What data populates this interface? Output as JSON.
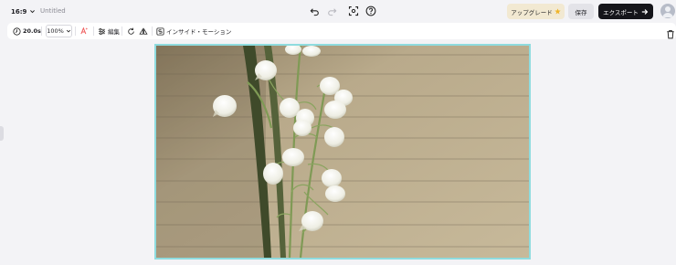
{
  "topbar": {
    "aspect_ratio": "16:9",
    "doc_title": "Untitled",
    "upgrade_label": "アップグレード",
    "save_label": "保存",
    "export_label": "エクスポート"
  },
  "toolbar": {
    "duration": "20.0s",
    "zoom": "100%",
    "edit_label": "編集",
    "insight_label": "インサイド・モーション"
  },
  "colors": {
    "accent_selection": "#8fdcdf",
    "export_bg": "#15151a",
    "upgrade_bg": "#f2e9d2",
    "ai_icon": "#ef5b5b"
  },
  "icons": [
    "chevron-down-icon",
    "undo-icon",
    "redo-icon",
    "ai-scan-icon",
    "help-icon",
    "star-icon",
    "arrow-right-icon",
    "timer-icon",
    "ai-text-icon",
    "sliders-icon",
    "rotate-icon",
    "flip-icon",
    "insight-icon",
    "trash-icon"
  ]
}
